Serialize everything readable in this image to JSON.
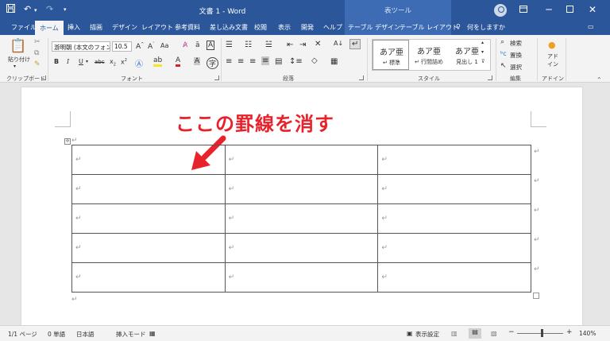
{
  "titlebar": {
    "document_title": "文書 1 - Word",
    "context_title": "表ツール",
    "save_icon": "save-icon",
    "undo_icon": "undo-icon",
    "redo_icon": "redo-icon",
    "customize_icon": "quick-access-dropdown-icon",
    "bg_color": "#2b579a"
  },
  "tabs": [
    {
      "label": "ファイル"
    },
    {
      "label": "ホーム",
      "active": true
    },
    {
      "label": "挿入"
    },
    {
      "label": "描画"
    },
    {
      "label": "デザイン"
    },
    {
      "label": "レイアウト"
    },
    {
      "label": "参考資料"
    },
    {
      "label": "差し込み文書"
    },
    {
      "label": "校閲"
    },
    {
      "label": "表示"
    },
    {
      "label": "開発"
    },
    {
      "label": "ヘルプ"
    },
    {
      "label": "テーブル デザイン"
    },
    {
      "label": "テーブル レイアウト"
    }
  ],
  "tell_me": "何をしますか",
  "ribbon": {
    "clipboard": {
      "paste_label": "貼り付け",
      "group_label": "クリップボード"
    },
    "font": {
      "font_name": "游明朝 (本文のフォン",
      "font_size": "10.5",
      "group_label": "フォント",
      "aa_label": "Aa"
    },
    "paragraph": {
      "group_label": "段落"
    },
    "styles": {
      "group_label": "スタイル",
      "items": [
        {
          "sample": "あア亜",
          "name": "↵ 標準"
        },
        {
          "sample": "あア亜",
          "name": "↵ 行間詰め"
        },
        {
          "sample": "あア亜",
          "name": "見出し 1"
        }
      ]
    },
    "editing": {
      "group_label": "編集",
      "find": "検索",
      "replace": "置換",
      "select": "選択"
    },
    "addins": {
      "group_label": "アドイン",
      "label": "アド\nイン"
    }
  },
  "document": {
    "instruction": "ここの罫線を消す",
    "instruction_color": "#e8222b",
    "para_mark": "↵",
    "table": {
      "rows": 5,
      "cols": 3,
      "cells": [
        [
          "↵",
          "↵",
          "↵"
        ],
        [
          "↵",
          "↵",
          "↵"
        ],
        [
          "↵",
          "↵",
          "↵"
        ],
        [
          "↵",
          "↵",
          "↵"
        ],
        [
          "↵",
          "↵",
          "↵"
        ]
      ]
    }
  },
  "statusbar": {
    "page": "1/1 ページ",
    "words": "0 単語",
    "language": "日本語",
    "mode": "挿入モード",
    "display_settings": "表示設定",
    "zoom": "140%",
    "zoom_minus": "−",
    "zoom_plus": "+"
  }
}
